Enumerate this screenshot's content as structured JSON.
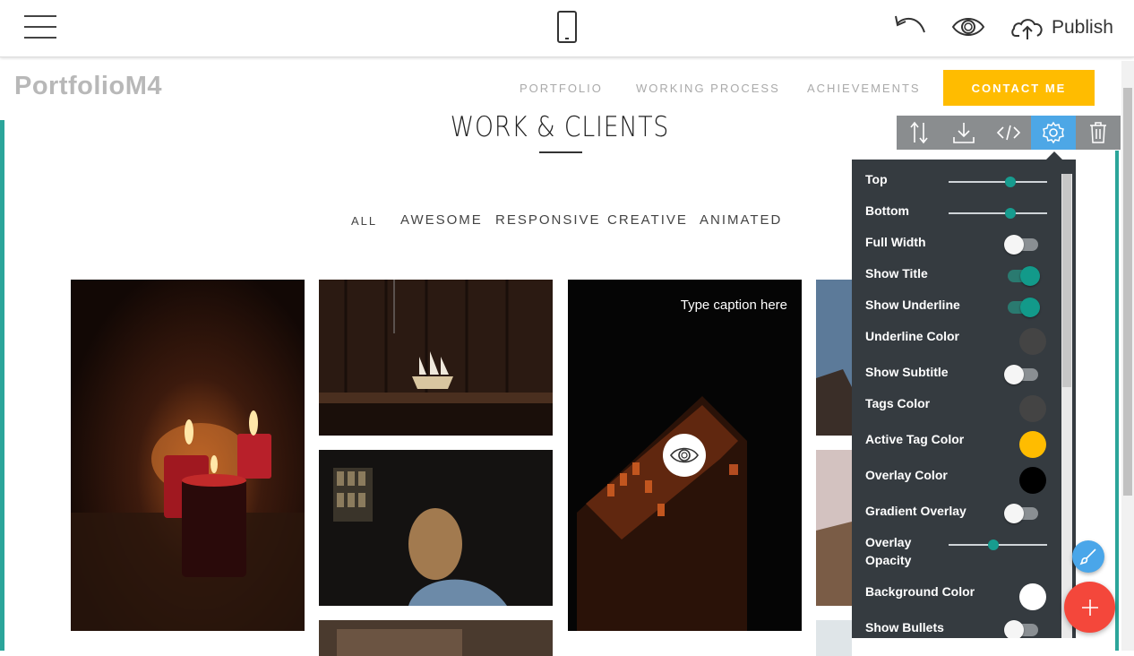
{
  "editor": {
    "publish_label": "Publish",
    "icons": [
      "menu-icon",
      "mobile-icon",
      "undo-icon",
      "preview-icon",
      "cloud-upload-icon"
    ]
  },
  "site": {
    "brand": "PortfolioM4",
    "nav": [
      "PORTFOLIO",
      "WORKING PROCESS",
      "ACHIEVEMENTS"
    ],
    "cta": "CONTACT ME",
    "cta_color": "#ffbc00"
  },
  "section": {
    "title": "WORK & CLIENTS",
    "tags": [
      "ALL",
      "AWESOME",
      "RESPONSIVE",
      "CREATIVE",
      "ANIMATED"
    ],
    "caption": "Type caption here"
  },
  "block_toolbar": {
    "buttons": [
      "reorder-icon",
      "download-icon",
      "code-icon",
      "settings-icon",
      "trash-icon"
    ],
    "active": "settings-icon"
  },
  "settings": {
    "top_label": "Top",
    "top_value": 0.63,
    "bottom_label": "Bottom",
    "bottom_value": 0.63,
    "full_width_label": "Full Width",
    "full_width": false,
    "show_title_label": "Show Title",
    "show_title": true,
    "show_underline_label": "Show Underline",
    "show_underline": true,
    "underline_color_label": "Underline Color",
    "underline_color": "#444444",
    "show_subtitle_label": "Show Subtitle",
    "show_subtitle": false,
    "tags_color_label": "Tags Color",
    "tags_color": "#444444",
    "active_tag_color_label": "Active Tag Color",
    "active_tag_color": "#ffbc00",
    "overlay_color_label": "Overlay Color",
    "overlay_color": "#000000",
    "gradient_overlay_label": "Gradient Overlay",
    "gradient_overlay": false,
    "overlay_opacity_label_1": "Overlay",
    "overlay_opacity_label_2": "Opacity",
    "overlay_opacity": 0.45,
    "background_color_label": "Background Color",
    "background_color": "#ffffff",
    "show_bullets_label": "Show Bullets",
    "show_bullets": false
  }
}
